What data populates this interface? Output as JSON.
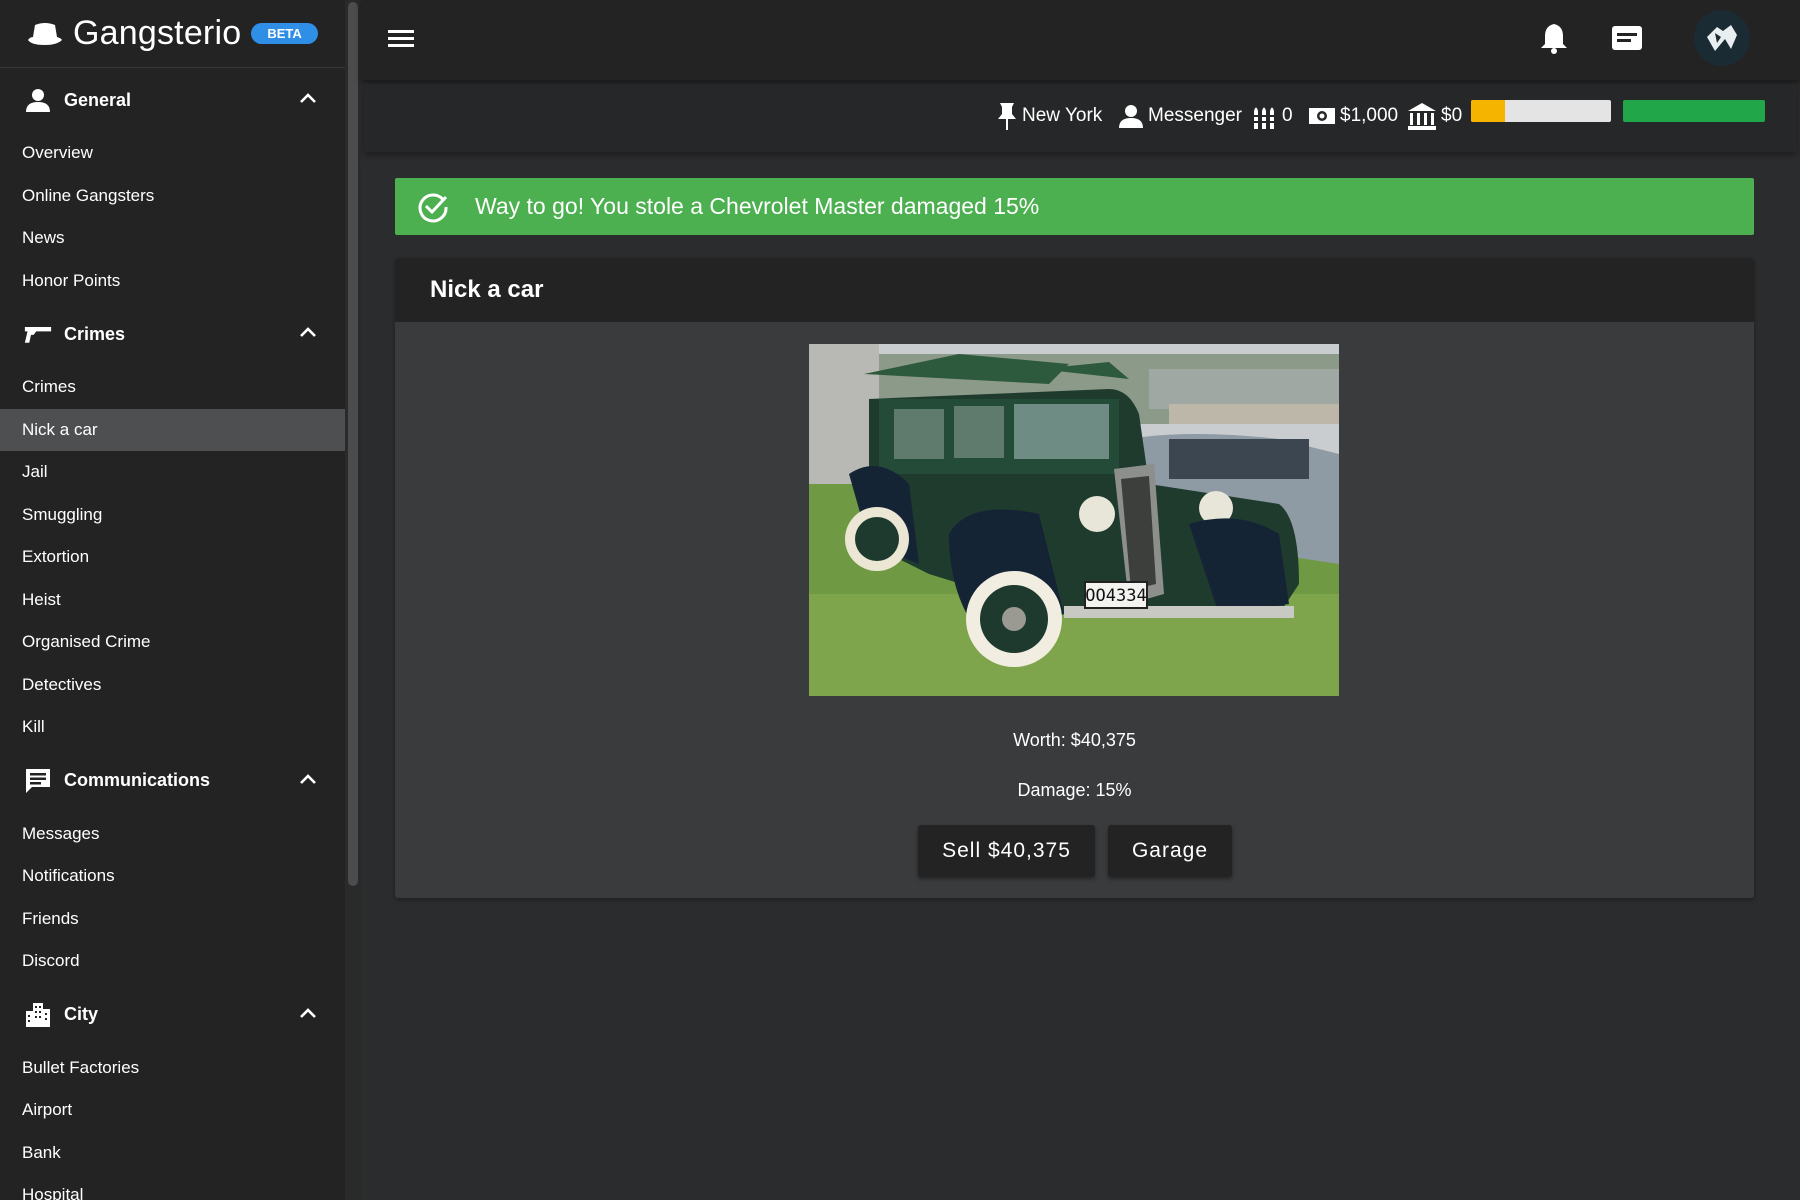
{
  "brand": {
    "name": "Gangsterio",
    "badge": "BETA"
  },
  "sidebar": {
    "sections": [
      {
        "label": "General",
        "icon": "person-icon",
        "items": [
          "Overview",
          "Online Gangsters",
          "News",
          "Honor Points"
        ]
      },
      {
        "label": "Crimes",
        "icon": "gun-icon",
        "items": [
          "Crimes",
          "Nick a car",
          "Jail",
          "Smuggling",
          "Extortion",
          "Heist",
          "Organised Crime",
          "Detectives",
          "Kill"
        ]
      },
      {
        "label": "Communications",
        "icon": "chat-icon",
        "items": [
          "Messages",
          "Notifications",
          "Friends",
          "Discord"
        ]
      },
      {
        "label": "City",
        "icon": "city-icon",
        "items": [
          "Bullet Factories",
          "Airport",
          "Bank",
          "Hospital"
        ]
      }
    ],
    "active_item": "Nick a car"
  },
  "topbar": {
    "icons": [
      "menu-icon",
      "bell-icon",
      "inbox-icon",
      "avatar"
    ]
  },
  "stats": {
    "location": "New York",
    "rank": "Messenger",
    "bullets": "0",
    "cash": "$1,000",
    "bank": "$0",
    "rank_progress": 0.24,
    "health": 1.0,
    "colors": {
      "rank_bar": "#f5b400",
      "rank_bar_bg": "#e4e4e4",
      "health_bar": "#22a64a"
    }
  },
  "alert": {
    "text": "Way to go! You stole a Chevrolet Master damaged 15%",
    "color": "#4caf50"
  },
  "card": {
    "title": "Nick a car",
    "plate": "OO4334",
    "worth": "Worth: $40,375",
    "damage": "Damage: 15%",
    "sell_label": "Sell $40,375",
    "garage_label": "Garage"
  }
}
